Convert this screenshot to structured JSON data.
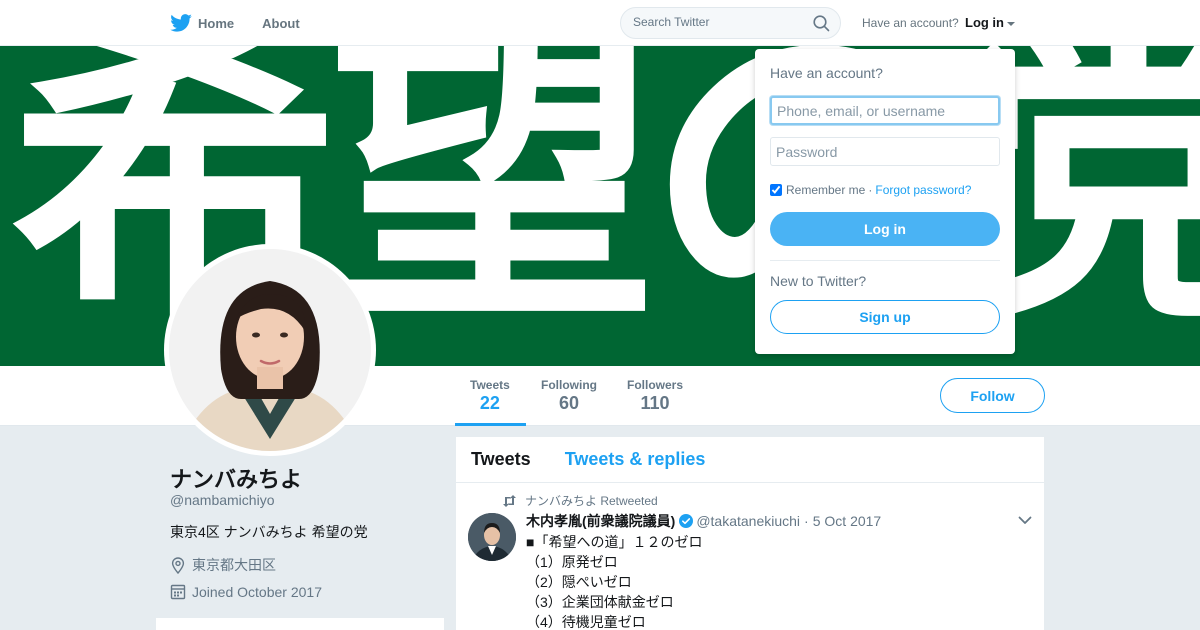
{
  "nav": {
    "home": "Home",
    "about": "About",
    "search_placeholder": "Search Twitter",
    "have_account": "Have an account?",
    "login": "Log in"
  },
  "banner": {
    "text": "希望の党"
  },
  "profile": {
    "name": "ナンバみちよ",
    "handle": "@nambamichiyo",
    "bio": "東京4区 ナンバみちよ 希望の党",
    "location": "東京都大田区",
    "joined": "Joined October 2017"
  },
  "stats": [
    {
      "label": "Tweets",
      "value": "22"
    },
    {
      "label": "Following",
      "value": "60"
    },
    {
      "label": "Followers",
      "value": "110"
    }
  ],
  "follow_button": "Follow",
  "timeline": {
    "tabs": [
      "Tweets",
      "Tweets & replies"
    ],
    "tweet": {
      "retweet_context": "ナンバみちよ Retweeted",
      "author_name": "木内孝胤(前衆議院議員)",
      "author_handle": "@takatanekiuchi",
      "dot": "·",
      "date": "5 Oct 2017",
      "lines": [
        "■「希望への道」１２のゼロ",
        "（1）原発ゼロ",
        "（2）隠ぺいゼロ",
        "（3）企業団体献金ゼロ",
        "（4）待機児童ゼロ"
      ]
    }
  },
  "login_dropdown": {
    "heading": "Have an account?",
    "username_placeholder": "Phone, email, or username",
    "password_placeholder": "Password",
    "remember_me": "Remember me",
    "separator": "·",
    "forgot_password": "Forgot password?",
    "login_button": "Log in",
    "new_to_twitter": "New to Twitter?",
    "signup_button": "Sign up"
  },
  "colors": {
    "brand_blue": "#1da1f2",
    "banner_green": "#006633",
    "background": "#e6ecf0"
  },
  "icons": [
    "twitter-bird-icon",
    "search-icon",
    "caret-down-icon",
    "location-icon",
    "calendar-icon",
    "retweet-icon",
    "verified-icon",
    "chevron-down-icon"
  ]
}
